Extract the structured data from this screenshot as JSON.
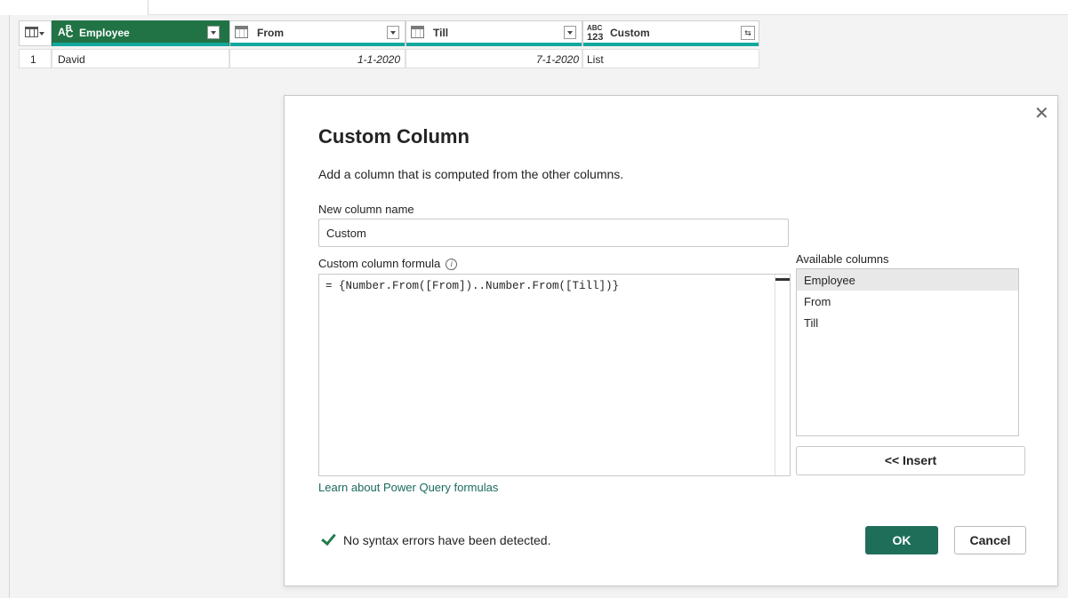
{
  "grid": {
    "columns": [
      {
        "name": "Employee",
        "type_icon": "text-type-icon",
        "type_top": "B",
        "type_left": "A",
        "type_sub": "C",
        "selected": true
      },
      {
        "name": "From",
        "type_icon": "date-type-icon",
        "selected": false
      },
      {
        "name": "Till",
        "type_icon": "date-type-icon",
        "selected": false
      },
      {
        "name": "Custom",
        "type_icon": "any-type-icon",
        "type_top": "ABC",
        "type_bottom": "123",
        "selected": false
      }
    ],
    "rows": [
      {
        "index": "1",
        "employee": "David",
        "from": "1-1-2020",
        "till": "7-1-2020",
        "custom": "List"
      }
    ]
  },
  "dialog": {
    "title": "Custom Column",
    "subtitle": "Add a column that is computed from the other columns.",
    "name_label": "New column name",
    "name_value": "Custom",
    "formula_label": "Custom column formula",
    "formula": "= {Number.From([From])..Number.From([Till])}",
    "available_label": "Available columns",
    "available_columns": [
      "Employee",
      "From",
      "Till"
    ],
    "insert_label": "<< Insert",
    "learn_link": "Learn about Power Query formulas",
    "status": "No syntax errors have been detected.",
    "ok_label": "OK",
    "cancel_label": "Cancel",
    "close_glyph": "✕",
    "info_glyph": "i"
  },
  "colors": {
    "selected_header": "#217346",
    "quality_bar": "#13a89e",
    "primary_button": "#1f6e5a",
    "link": "#1b6a5b",
    "check": "#237b4b"
  }
}
